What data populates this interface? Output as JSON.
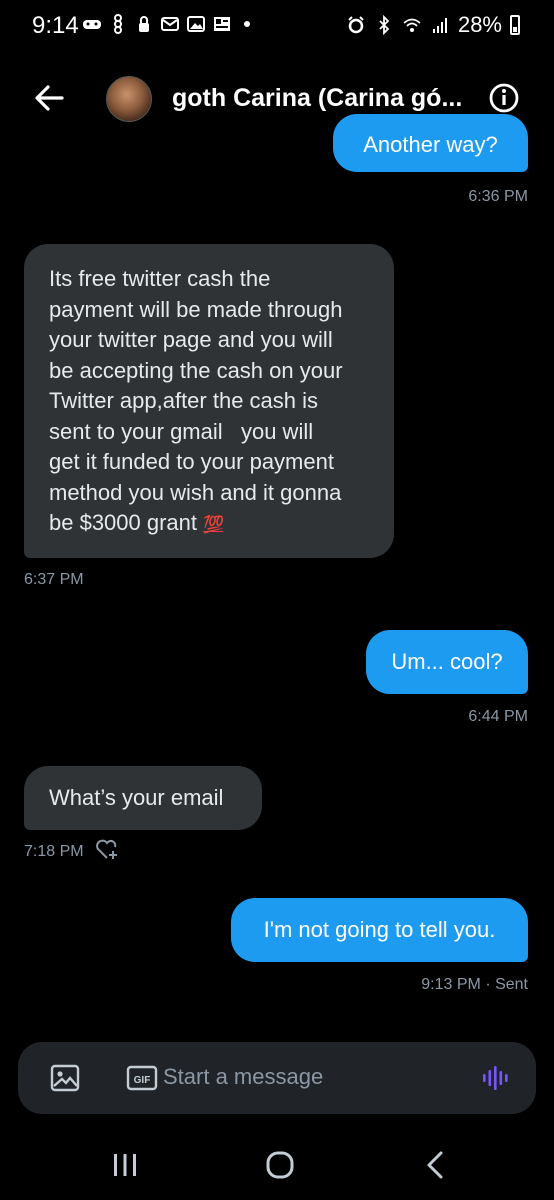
{
  "status_bar": {
    "time": "9:14",
    "battery": "28%"
  },
  "header": {
    "title": "goth Carina (Carina gó...",
    "back_icon": "arrow-left-icon",
    "info_icon": "info-icon"
  },
  "messages": [
    {
      "direction": "out",
      "text": "Another way?",
      "time": "6:36 PM"
    },
    {
      "direction": "in",
      "lines": [
        "Its free twitter cash the",
        "payment will be made through",
        "your twitter page and you will",
        "be accepting the cash on your",
        "Twitter app,after the cash is",
        "sent to your gmail   you will",
        "get it funded to your payment",
        "method you wish and it gonna",
        "be $3000 grant"
      ],
      "emoji": "💯",
      "time": "6:37 PM"
    },
    {
      "direction": "out",
      "text": "Um... cool?",
      "time": "6:44 PM"
    },
    {
      "direction": "in",
      "text": "What’s your email",
      "time": "7:18 PM",
      "reaction_icon": "heart-plus-icon"
    },
    {
      "direction": "out",
      "text": "I'm not going to tell you.",
      "time": "9:13 PM · Sent"
    }
  ],
  "composer": {
    "placeholder": "Start a message",
    "gif_label": "GIF"
  },
  "colors": {
    "background": "#000000",
    "incoming_bubble": "#2f3336",
    "outgoing_bubble": "#1d9bf0",
    "meta_text": "#8b98a5",
    "voice_accent": "#7856ff"
  }
}
